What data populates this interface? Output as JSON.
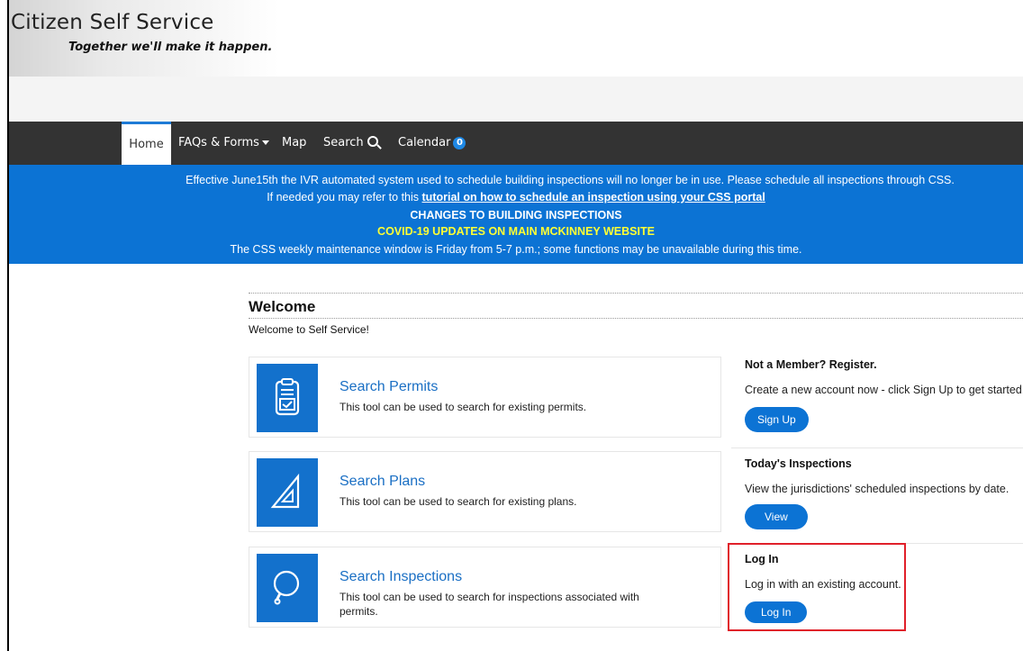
{
  "header": {
    "title": "Citizen Self Service",
    "tagline": "Together we'll make it happen."
  },
  "nav": {
    "items": [
      {
        "label": "Home"
      },
      {
        "label": "FAQs & Forms"
      },
      {
        "label": "Map"
      },
      {
        "label": "Search"
      },
      {
        "label": "Calendar"
      }
    ],
    "calendar_count": "0"
  },
  "banner": {
    "line1": "Effective June15th the IVR automated system used to schedule building inspections will no longer be in use. Please schedule all inspections through CSS.",
    "line2_prefix": "If needed you may refer to this ",
    "line2_link": "tutorial on how to schedule an inspection using your CSS portal",
    "line3": "CHANGES TO BUILDING INSPECTIONS",
    "line4": "COVID-19 UPDATES ON MAIN MCKINNEY WEBSITE",
    "line5": "The CSS weekly maintenance window is Friday from 5-7 p.m.; some functions may be unavailable during this time."
  },
  "welcome": {
    "title": "Welcome",
    "text": "Welcome to Self Service!"
  },
  "tools": [
    {
      "title": "Search Permits",
      "desc": "This tool can be used to search for existing permits.",
      "icon": "clipboard-check-icon"
    },
    {
      "title": "Search Plans",
      "desc": "This tool can be used to search for existing plans.",
      "icon": "set-square-icon"
    },
    {
      "title": "Search Inspections",
      "desc": "This tool can be used to search for inspections associated with permits.",
      "icon": "magnifier-icon"
    }
  ],
  "side": {
    "register": {
      "title": "Not a Member? Register.",
      "text": "Create a new account now - click Sign Up to get started.",
      "button": "Sign Up"
    },
    "inspections": {
      "title": "Today's Inspections",
      "text": "View the jurisdictions' scheduled inspections by date.",
      "button": "View"
    },
    "login": {
      "title": "Log In",
      "text": "Log in with an existing account.",
      "button": "Log In"
    }
  },
  "colors": {
    "nav_bg": "#333333",
    "banner_bg": "#0c73d4",
    "accent": "#1371cc",
    "highlight": "#e0202a",
    "banner_yellow": "#ffff33"
  }
}
